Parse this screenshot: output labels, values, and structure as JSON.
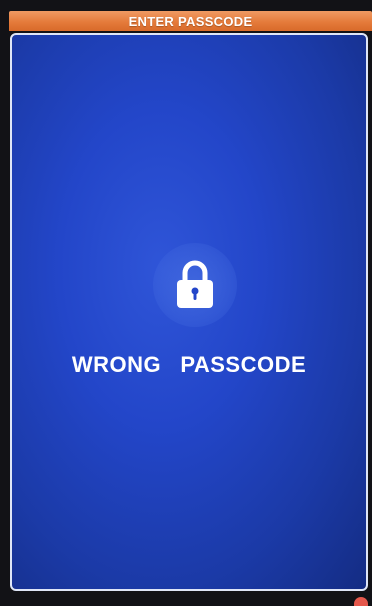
{
  "header": {
    "title": "ENTER PASSCODE"
  },
  "main": {
    "lock_icon": "lock-icon",
    "message": "WRONG  PASSCODE"
  },
  "colors": {
    "title_bar": "#e57b3b",
    "panel": "#2346c9",
    "text": "#ffffff"
  }
}
